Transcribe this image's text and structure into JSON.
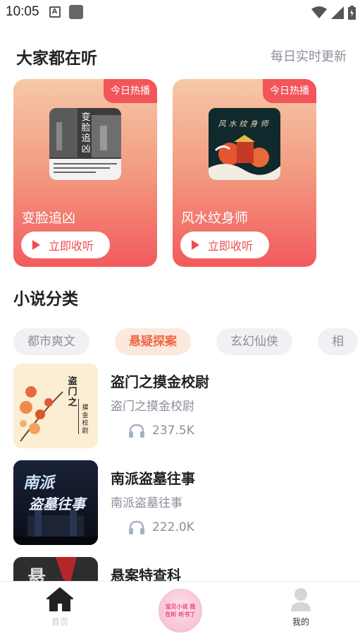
{
  "status_bar": {
    "time": "10:05",
    "notification_icon": "A"
  },
  "header": {
    "title": "大家都在听",
    "subtitle": "每日实时更新"
  },
  "hot_cards": [
    {
      "badge": "今日热播",
      "title": "变脸追凶",
      "button_label": "立即收听",
      "cover_text": "变脸追凶"
    },
    {
      "badge": "今日热播",
      "title": "风水纹身师",
      "button_label": "立即收听",
      "cover_text": "风水纹身师"
    }
  ],
  "categories": {
    "title": "小说分类",
    "tabs": [
      "都市爽文",
      "悬疑探案",
      "玄幻仙侠",
      "相"
    ],
    "active_index": 1
  },
  "books": [
    {
      "title": "盗门之摸金校尉",
      "author": "盗门之摸金校尉",
      "listens": "237.5K",
      "cover_text_main": "盗门之",
      "cover_text_sub": "摸金校尉"
    },
    {
      "title": "南派盗墓往事",
      "author": "南派盗墓往事",
      "listens": "222.0K",
      "cover_text_main": "南派",
      "cover_text_sub": "盗墓往事"
    },
    {
      "title": "悬案特查科",
      "author": "",
      "listens": "",
      "cover_text_main": "悬",
      "cover_text_sub": ""
    }
  ],
  "bottom_nav": {
    "home_label": "首页",
    "center_text": "宝贝小说 我在听 听书了",
    "mine_label": "我的"
  },
  "colors": {
    "accent": "#ef4b4f",
    "tab_active_text": "#ef6a45",
    "muted": "#8a8f99"
  }
}
